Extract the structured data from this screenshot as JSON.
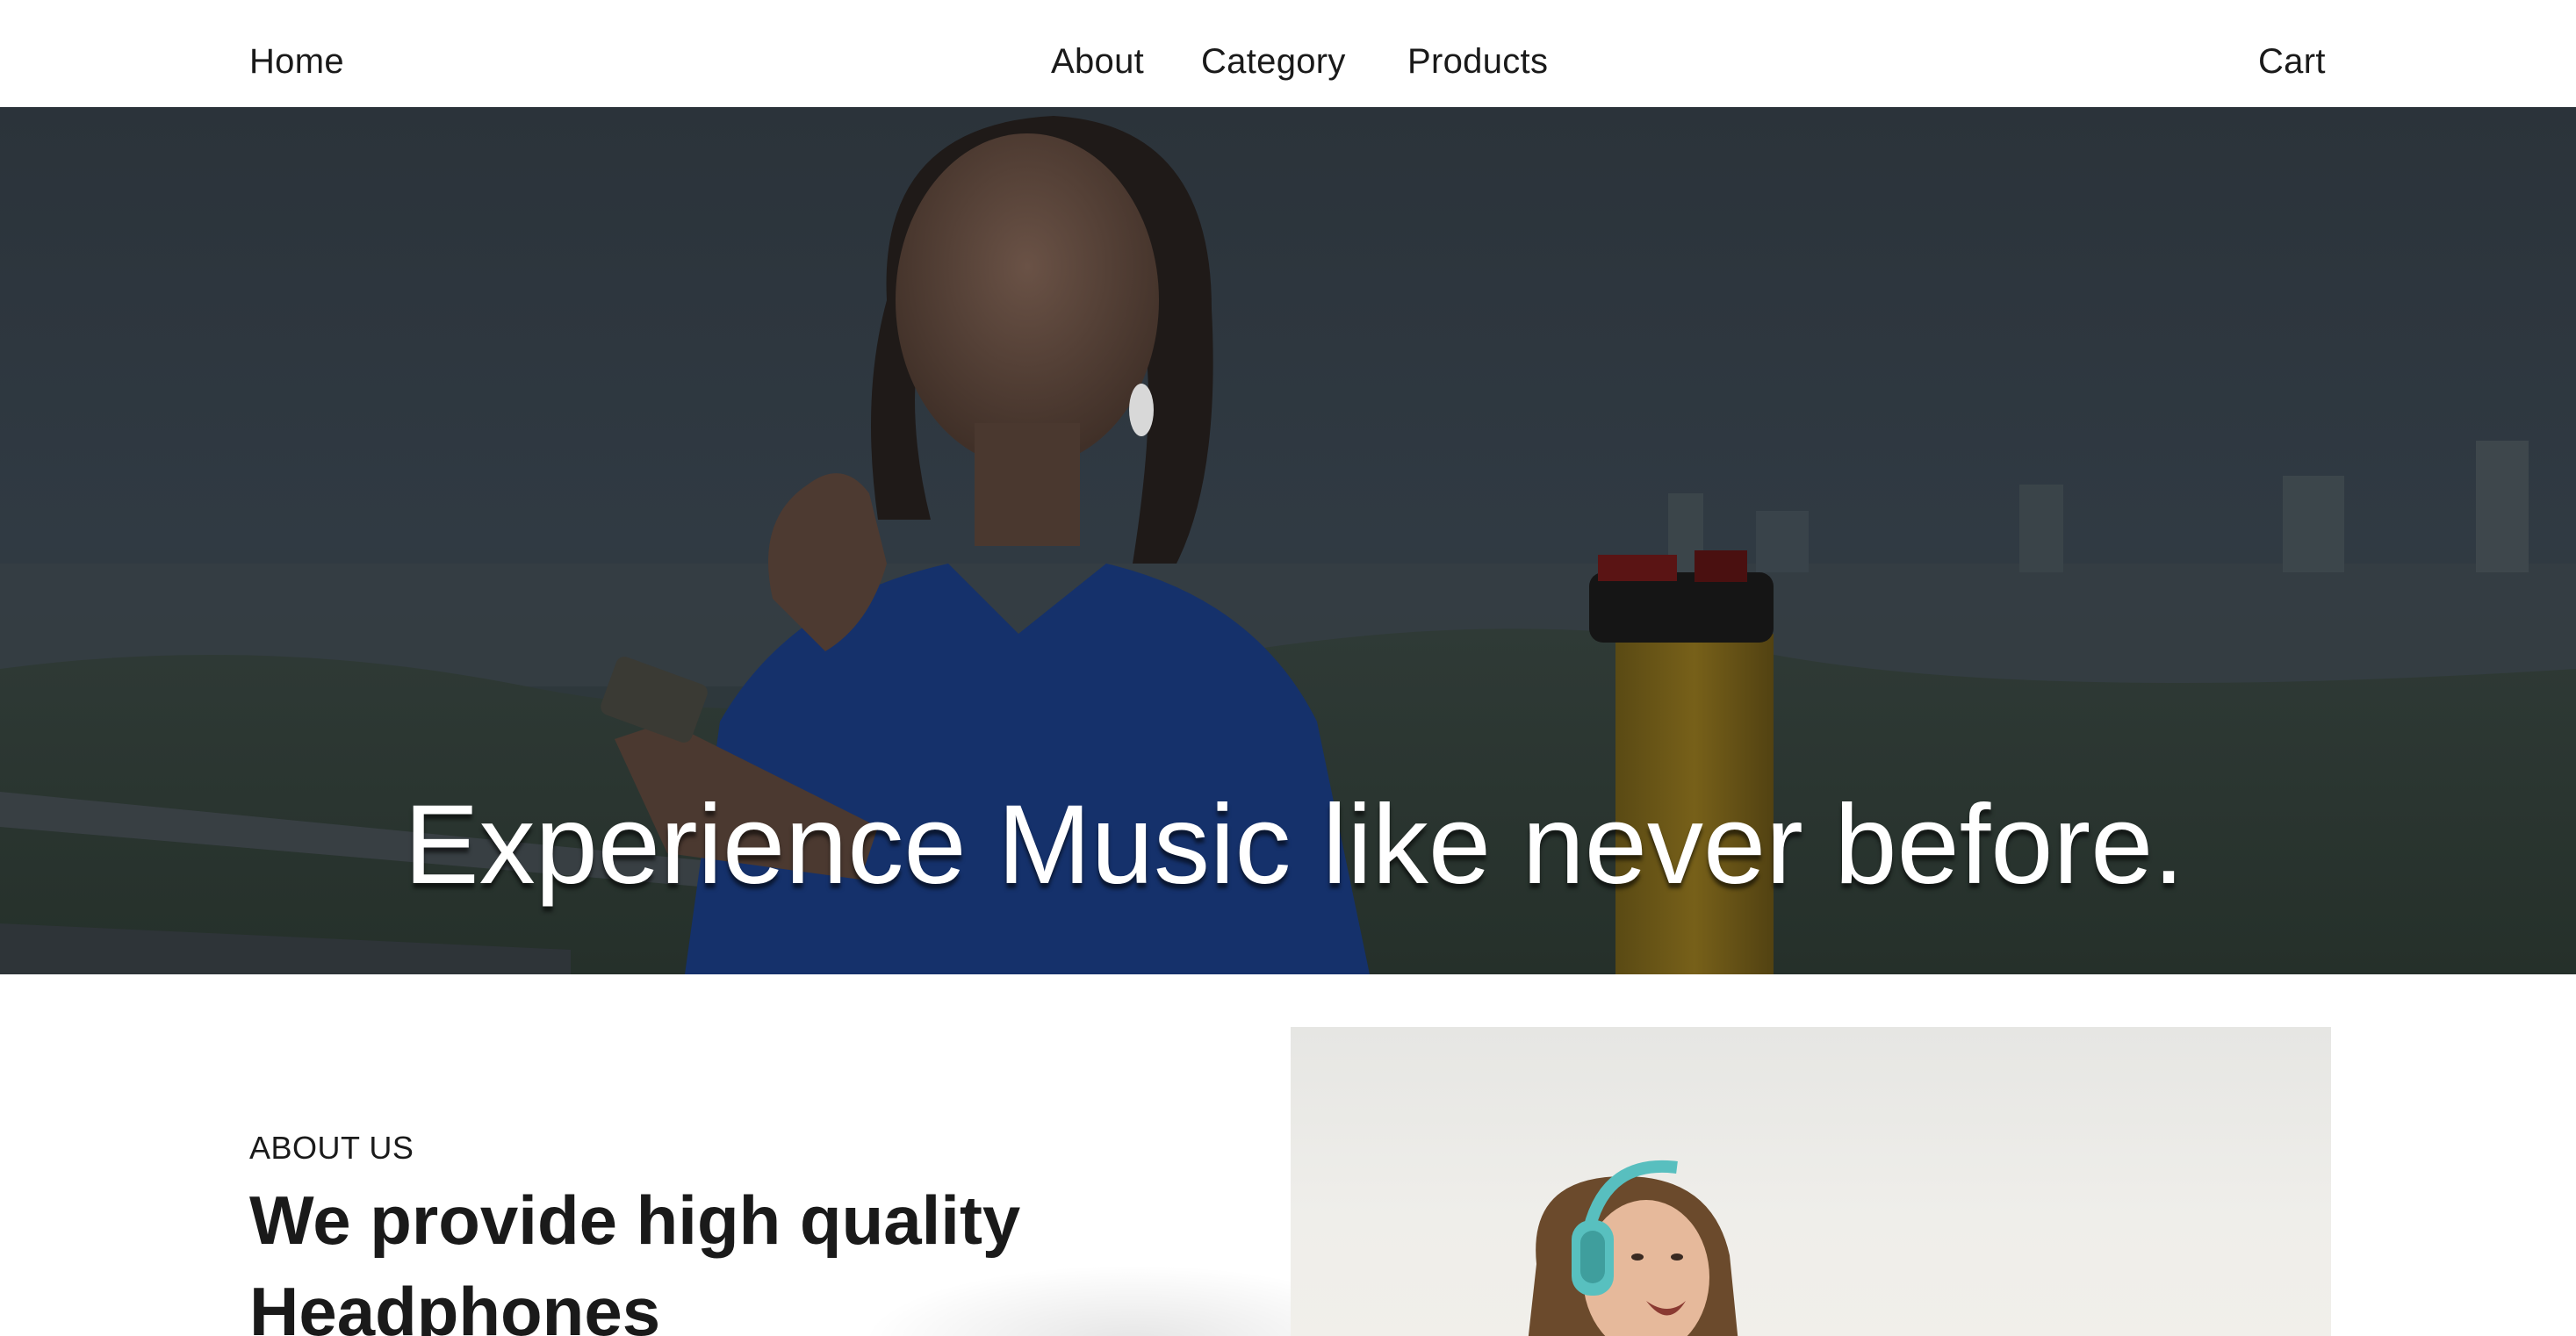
{
  "nav": {
    "home": "Home",
    "about": "About",
    "category": "Category",
    "products": "Products",
    "cart": "Cart"
  },
  "hero": {
    "title": "Experience Music like never before."
  },
  "about": {
    "kicker": "ABOUT US",
    "heading": "We provide high quality Headphones"
  }
}
